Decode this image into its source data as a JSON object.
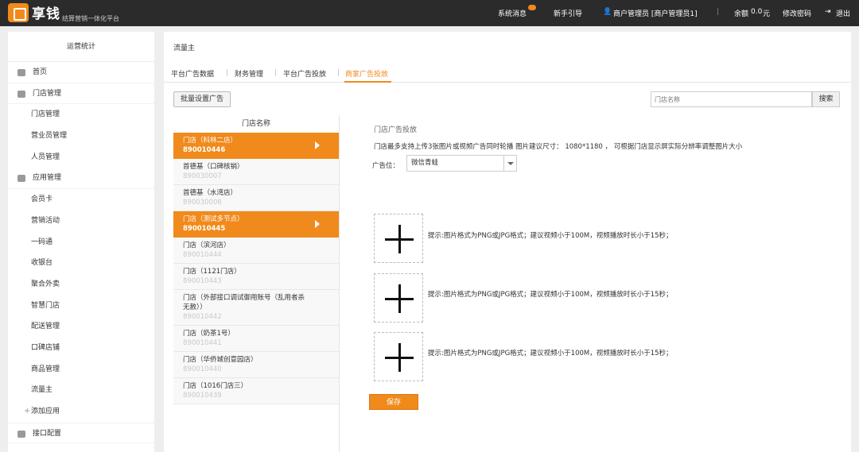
{
  "app": {
    "logo_text": "享钱",
    "logo_sub": "结算营销一体化平台"
  },
  "topnav": {
    "messages": "系统消息",
    "guide": "新手引导",
    "user": "商户管理员 [商户管理员1]",
    "balance_label": "余额",
    "balance_value": "0.0",
    "balance_unit": "元",
    "change_password": "修改密码",
    "logout": "退出"
  },
  "sidebar": {
    "header": "运营统计",
    "home": "首页",
    "store_group": "门店管理",
    "store_items": [
      "门店管理",
      "营业员管理",
      "人员管理"
    ],
    "app_group": "应用管理",
    "app_items": [
      "会员卡",
      "营销活动",
      "一码通",
      "收银台",
      "聚合外卖",
      "智慧门店",
      "配送管理",
      "口碑店铺",
      "商品管理",
      "流量主"
    ],
    "add_app": "添加应用",
    "api_config": "接口配置"
  },
  "main": {
    "breadcrumb": "流量主",
    "tabs": [
      "平台广告数据",
      "财务管理",
      "平台广告投放",
      "商家广告投放"
    ],
    "batch_button": "批量设置广告",
    "search_placeholder": "门店名称",
    "search_button": "搜索",
    "store_header": "门店名称",
    "stores": [
      {
        "name": "门店（科林二店）",
        "code": "890010446",
        "selected": true
      },
      {
        "name": "首德基（口碑核销）",
        "code": "890030007",
        "selected": false
      },
      {
        "name": "首德基（水湾店）",
        "code": "890030006",
        "selected": false
      },
      {
        "name": "门店（测试多节点）",
        "code": "890010445",
        "selected": true
      },
      {
        "name": "门店（滨河店）",
        "code": "890010444",
        "selected": false
      },
      {
        "name": "门店（1121门店）",
        "code": "890010443",
        "selected": false
      },
      {
        "name": "门店（外部接口调试御用账号（乱用者杀无赦））",
        "code": "890010442",
        "selected": false
      },
      {
        "name": "门店（奶茶1号）",
        "code": "890010441",
        "selected": false
      },
      {
        "name": "门店（华侨城创意园店）",
        "code": "890010440",
        "selected": false
      },
      {
        "name": "门店（1016门店三）",
        "code": "890010439",
        "selected": false
      }
    ],
    "ad": {
      "title": "门店广告投放",
      "tip": "门店最多支持上传3张图片或视频广告同时轮播 图片建议尺寸： 1080*1180 ， 可根据门店显示屏实际分辨率调整图片大小",
      "position_label": "广告位：",
      "position_value": "微信青蛙",
      "upload_hint": "提示:图片格式为PNG或JPG格式；建议视频小于100M，视频播放时长小于15秒；",
      "save": "保存"
    }
  },
  "colors": {
    "accent": "#f08a1c",
    "topbar": "#2b2b2b"
  }
}
